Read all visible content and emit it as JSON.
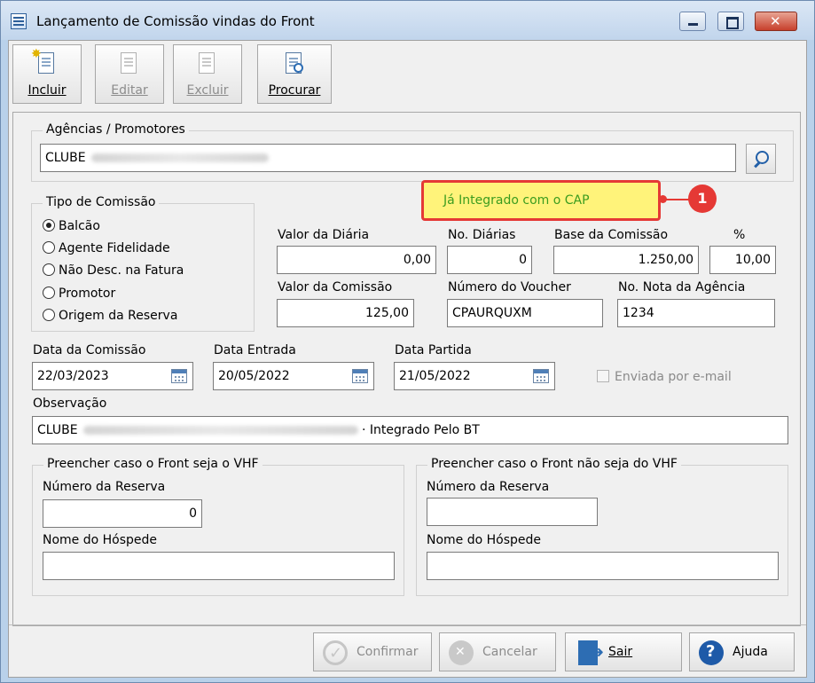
{
  "window": {
    "title": "Lançamento de Comissão vindas do Front"
  },
  "toolbar": {
    "include": "Incluir",
    "edit": "Editar",
    "delete": "Excluir",
    "search": "Procurar"
  },
  "agencies": {
    "group_title": "Agências / Promotores",
    "value": "CLUBE"
  },
  "commission_type": {
    "group_title": "Tipo de Comissão",
    "options": [
      "Balcão",
      "Agente Fidelidade",
      "Não Desc. na Fatura",
      "Promotor",
      "Origem da Reserva"
    ],
    "selected": "Balcão"
  },
  "badge": {
    "text": "Já Integrado com o CAP",
    "callout_number": "1"
  },
  "fields": {
    "daily_value_label": "Valor da Diária",
    "daily_value": "0,00",
    "num_days_label": "No. Diárias",
    "num_days": "0",
    "commission_base_label": "Base da Comissão",
    "commission_base": "1.250,00",
    "percent_label": "%",
    "percent": "10,00",
    "commission_value_label": "Valor da Comissão",
    "commission_value": "125,00",
    "voucher_label": "Número do Voucher",
    "voucher": "CPAURQUXM",
    "agency_note_label": "No. Nota da Agência",
    "agency_note": "1234"
  },
  "dates": {
    "commission_label": "Data da Comissão",
    "commission": "22/03/2023",
    "entry_label": "Data Entrada",
    "entry": "20/05/2022",
    "departure_label": "Data Partida",
    "departure": "21/05/2022"
  },
  "email_checkbox": {
    "label": "Enviada por e-mail",
    "checked": false
  },
  "observation": {
    "label": "Observação",
    "prefix": "CLUBE",
    "suffix": "· Integrado Pelo BT"
  },
  "vhf_group": {
    "title": "Preencher caso o Front seja o VHF",
    "reservation_label": "Número da Reserva",
    "reservation": "0",
    "guest_label": "Nome do Hóspede",
    "guest": ""
  },
  "non_vhf_group": {
    "title": "Preencher caso o Front não seja do VHF",
    "reservation_label": "Número da Reserva",
    "reservation": "",
    "guest_label": "Nome do Hóspede",
    "guest": ""
  },
  "buttons": {
    "confirm": "Confirmar",
    "cancel": "Cancelar",
    "exit": "Sair",
    "help": "Ajuda"
  },
  "colors": {
    "badge_background": "#fff37a",
    "badge_border": "#e53935",
    "badge_text": "#3b9c1f",
    "callout": "#e53935"
  }
}
